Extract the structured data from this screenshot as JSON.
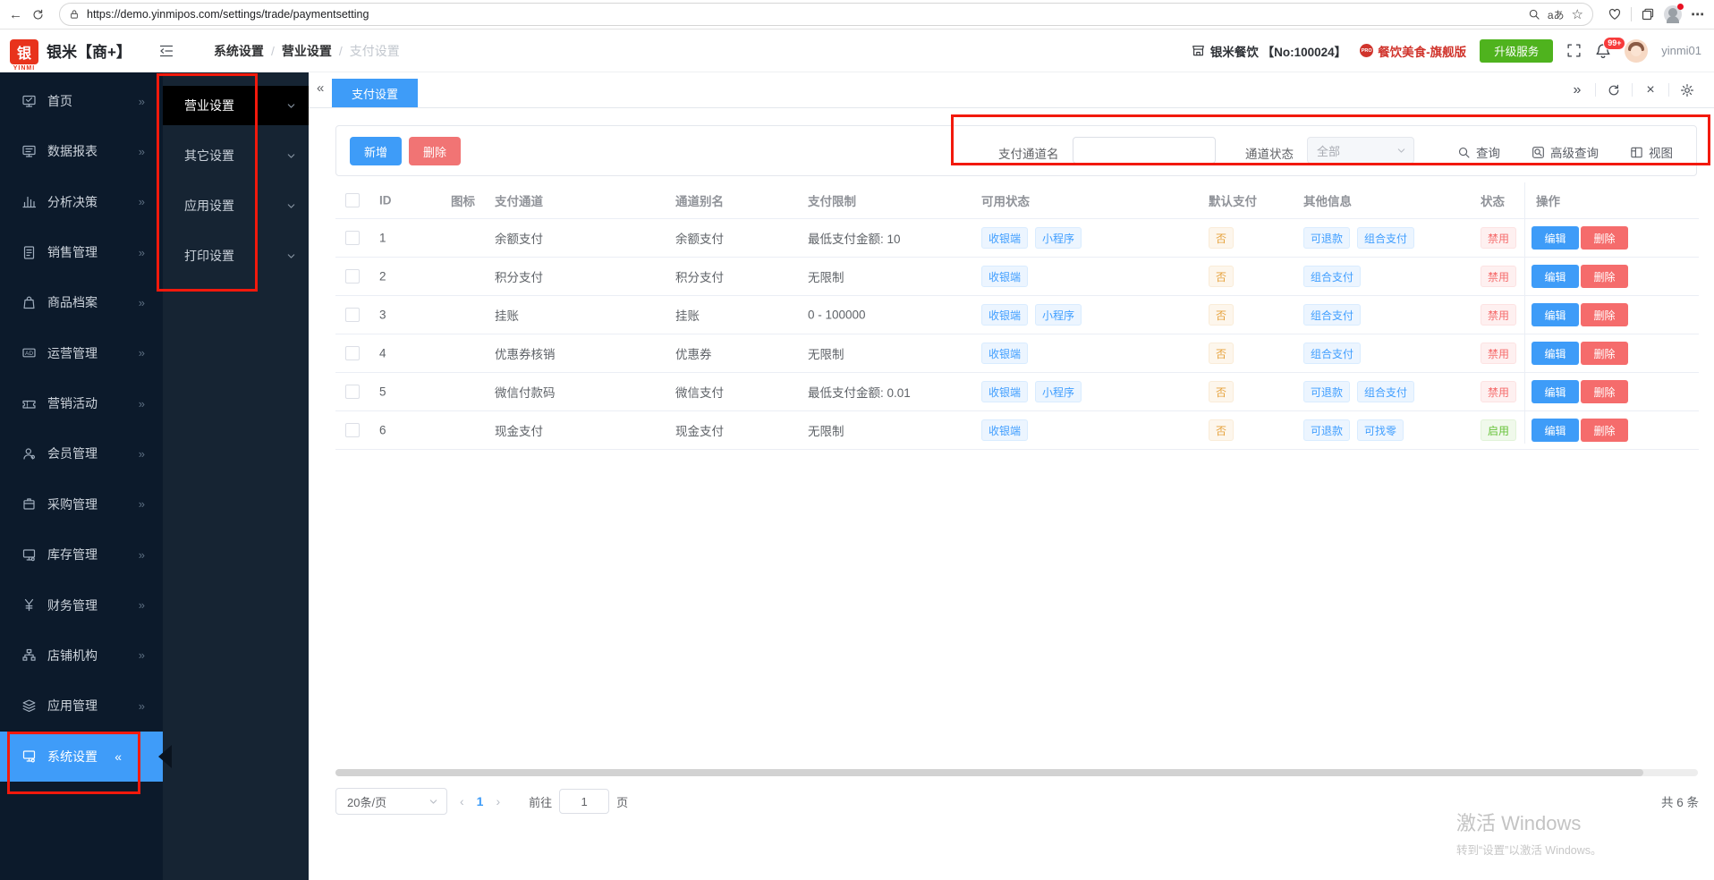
{
  "browser": {
    "url": "https://demo.yinmipos.com/settings/trade/paymentsetting",
    "translate_label": "aあ",
    "menu_dots": "⋯",
    "back_glyph": "←",
    "star_glyph": "☆"
  },
  "header": {
    "logo_char": "银",
    "logo_brand": "YINMI",
    "brand": "银米【商+】",
    "breadcrumb": [
      "系统设置",
      "营业设置",
      "支付设置"
    ],
    "store_label": "银米餐饮 【No:100024】",
    "edition_badge": "PRO",
    "edition_label": "餐饮美食-旗舰版",
    "upgrade_label": "升级服务",
    "notification_count": "99+",
    "username": "yinmi01"
  },
  "sidebar": {
    "items": [
      {
        "label": "首页",
        "icon": "home-icon"
      },
      {
        "label": "数据报表",
        "icon": "report-icon"
      },
      {
        "label": "分析决策",
        "icon": "analysis-icon"
      },
      {
        "label": "销售管理",
        "icon": "sales-icon"
      },
      {
        "label": "商品档案",
        "icon": "goods-icon"
      },
      {
        "label": "运营管理",
        "icon": "operation-icon"
      },
      {
        "label": "营销活动",
        "icon": "marketing-icon"
      },
      {
        "label": "会员管理",
        "icon": "member-icon"
      },
      {
        "label": "采购管理",
        "icon": "purchase-icon"
      },
      {
        "label": "库存管理",
        "icon": "inventory-icon"
      },
      {
        "label": "财务管理",
        "icon": "finance-icon"
      },
      {
        "label": "店铺机构",
        "icon": "org-icon"
      },
      {
        "label": "应用管理",
        "icon": "apps-icon"
      },
      {
        "label": "系统设置",
        "icon": "system-icon",
        "active": true
      }
    ]
  },
  "submenu": {
    "items": [
      {
        "label": "营业设置",
        "active": true
      },
      {
        "label": "其它设置"
      },
      {
        "label": "应用设置"
      },
      {
        "label": "打印设置"
      }
    ]
  },
  "tabs": {
    "active_tab": "支付设置"
  },
  "toolbar": {
    "add_label": "新增",
    "delete_label": "删除",
    "channel_name_label": "支付通道名",
    "channel_status_label": "通道状态",
    "channel_status_value": "全部",
    "search_label": "查询",
    "advanced_search_label": "高级查询",
    "view_label": "视图"
  },
  "table": {
    "columns": [
      "ID",
      "图标",
      "支付通道",
      "通道别名",
      "支付限制",
      "可用状态",
      "默认支付",
      "其他信息",
      "状态",
      "操作"
    ],
    "edit_label": "编辑",
    "delete_label": "删除",
    "rows": [
      {
        "id": "1",
        "channel": "余额支付",
        "alias": "余额支付",
        "limit": "最低支付金额: 10",
        "available": [
          "收银端",
          "小程序"
        ],
        "default_pay": "否",
        "other": [
          "可退款",
          "组合支付"
        ],
        "status": "禁用",
        "status_type": "disabled"
      },
      {
        "id": "2",
        "channel": "积分支付",
        "alias": "积分支付",
        "limit": "无限制",
        "available": [
          "收银端"
        ],
        "default_pay": "否",
        "other": [
          "组合支付"
        ],
        "status": "禁用",
        "status_type": "disabled"
      },
      {
        "id": "3",
        "channel": "挂账",
        "alias": "挂账",
        "limit": "0 - 100000",
        "available": [
          "收银端",
          "小程序"
        ],
        "default_pay": "否",
        "other": [
          "组合支付"
        ],
        "status": "禁用",
        "status_type": "disabled"
      },
      {
        "id": "4",
        "channel": "优惠券核销",
        "alias": "优惠券",
        "limit": "无限制",
        "available": [
          "收银端"
        ],
        "default_pay": "否",
        "other": [
          "组合支付"
        ],
        "status": "禁用",
        "status_type": "disabled"
      },
      {
        "id": "5",
        "channel": "微信付款码",
        "alias": "微信支付",
        "limit": "最低支付金额: 0.01",
        "available": [
          "收银端",
          "小程序"
        ],
        "default_pay": "否",
        "other": [
          "可退款",
          "组合支付"
        ],
        "status": "禁用",
        "status_type": "disabled"
      },
      {
        "id": "6",
        "channel": "现金支付",
        "alias": "现金支付",
        "limit": "无限制",
        "available": [
          "收银端"
        ],
        "default_pay": "否",
        "other": [
          "可退款",
          "可找零"
        ],
        "status": "启用",
        "status_type": "enabled"
      }
    ]
  },
  "pagination": {
    "page_size": "20条/页",
    "current_page": "1",
    "goto_label": "前往",
    "goto_value": "1",
    "page_unit": "页",
    "total": "共 6 条"
  },
  "watermark": {
    "line1": "激活 Windows",
    "line2": "转到“设置”以激活 Windows。"
  },
  "colors": {
    "accent": "#3e9cf8",
    "danger": "#f56c6c",
    "success": "#67c23a",
    "warning": "#e6a23c",
    "annotation": "#f2190c",
    "sidebar_bg": "#0c1a2b",
    "upgrade_green": "#4fb31e"
  }
}
